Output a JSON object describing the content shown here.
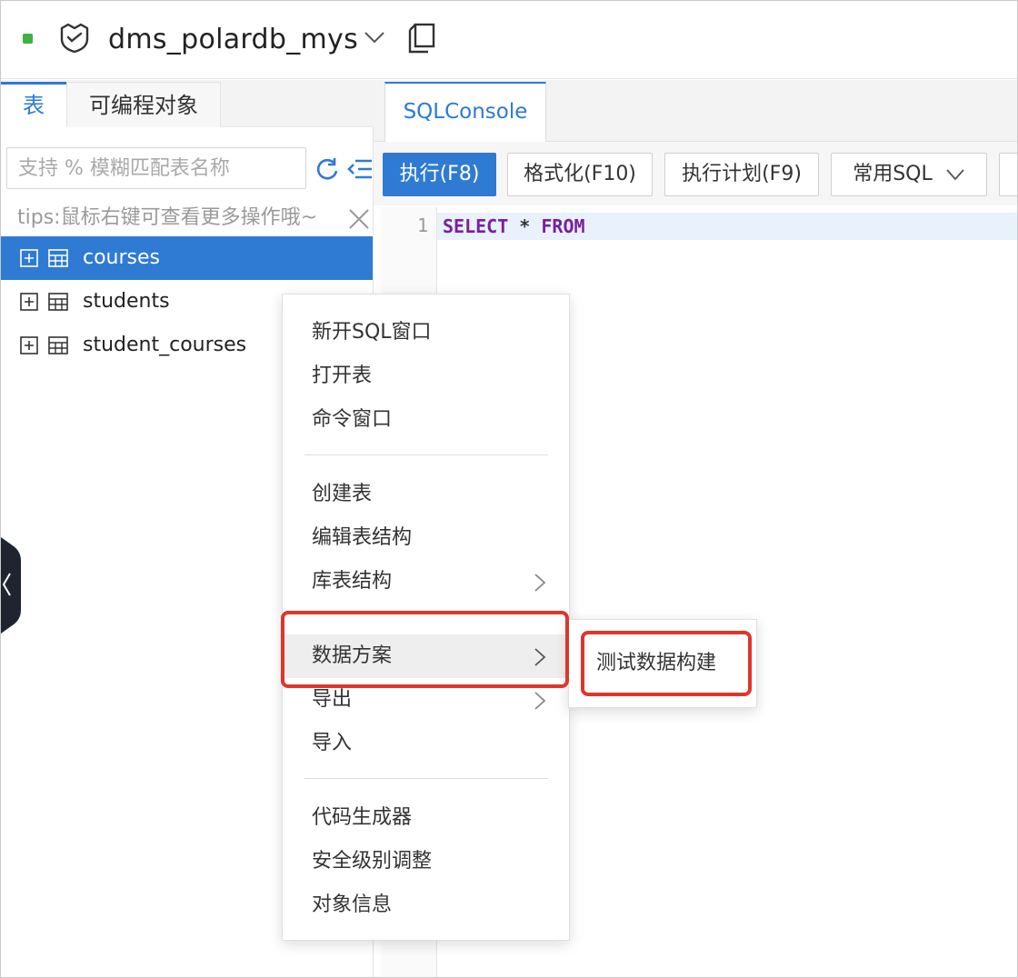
{
  "header": {
    "db_name": "dms_polardb_mys",
    "status_color": "#3db33d",
    "icons": [
      "db-engine-icon",
      "chevron-down-icon",
      "copy-icon"
    ]
  },
  "left_panel": {
    "tabs": [
      {
        "label": "表",
        "active": true
      },
      {
        "label": "可编程对象",
        "active": false
      }
    ],
    "search_placeholder": "支持 % 模糊匹配表名称",
    "tips": "tips:鼠标右键可查看更多操作哦~",
    "tables": [
      {
        "name": "courses",
        "selected": true
      },
      {
        "name": "students",
        "selected": false
      },
      {
        "name": "student_courses",
        "selected": false
      }
    ]
  },
  "console": {
    "tab_label": "SQLConsole",
    "toolbar": {
      "run": "执行(F8)",
      "format": "格式化(F10)",
      "plan": "执行计划(F9)",
      "common_sql": "常用SQL"
    },
    "editor": {
      "line_number": "1",
      "kw_select": "SELECT",
      "star": "*",
      "kw_from": "FROM"
    }
  },
  "context_menu": {
    "group1": [
      "新开SQL窗口",
      "打开表",
      "命令窗口"
    ],
    "group2": [
      "创建表",
      "编辑表结构",
      "库表结构",
      "数据方案",
      "导出",
      "导入"
    ],
    "group3": [
      "代码生成器",
      "安全级别调整",
      "对象信息"
    ],
    "hover_item": "数据方案",
    "submenu_items": [
      "测试数据构建"
    ]
  },
  "colors": {
    "accent": "#2f7bd3",
    "keyword": "#7a1f9e",
    "highlight": "#e0352b"
  }
}
